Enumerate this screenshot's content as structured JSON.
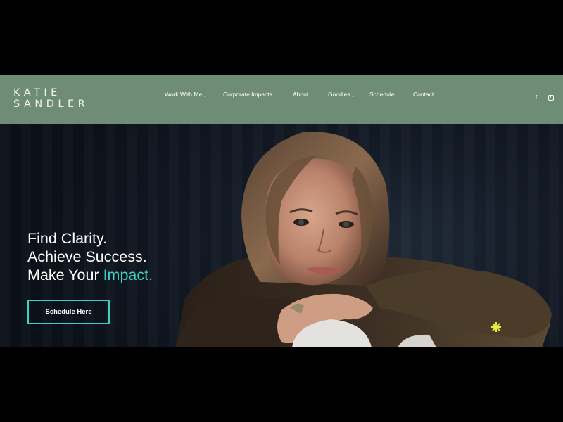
{
  "brand": {
    "name_line1": "KATIE",
    "name_line2": "SANDLER"
  },
  "nav": {
    "items": [
      {
        "label": "Work With Me",
        "has_dropdown": true
      },
      {
        "label": "Corporate Impacts",
        "has_dropdown": false
      },
      {
        "label": "About",
        "has_dropdown": false
      },
      {
        "label": "Goodies",
        "has_dropdown": true
      },
      {
        "label": "Schedule",
        "has_dropdown": false
      },
      {
        "label": "Contact",
        "has_dropdown": false
      }
    ],
    "social": [
      {
        "icon": "facebook-icon",
        "glyph": "f"
      },
      {
        "icon": "instagram-icon"
      }
    ]
  },
  "hero": {
    "line1": "Find Clarity.",
    "line2": "Achieve Success.",
    "line3_prefix": "Make Your ",
    "line3_accent": "Impact.",
    "cta_label": "Schedule Here"
  },
  "colors": {
    "header_bg": "#6f8c74",
    "accent": "#3fd0c4",
    "hero_bg": "#141b27",
    "text": "#ffffff"
  }
}
